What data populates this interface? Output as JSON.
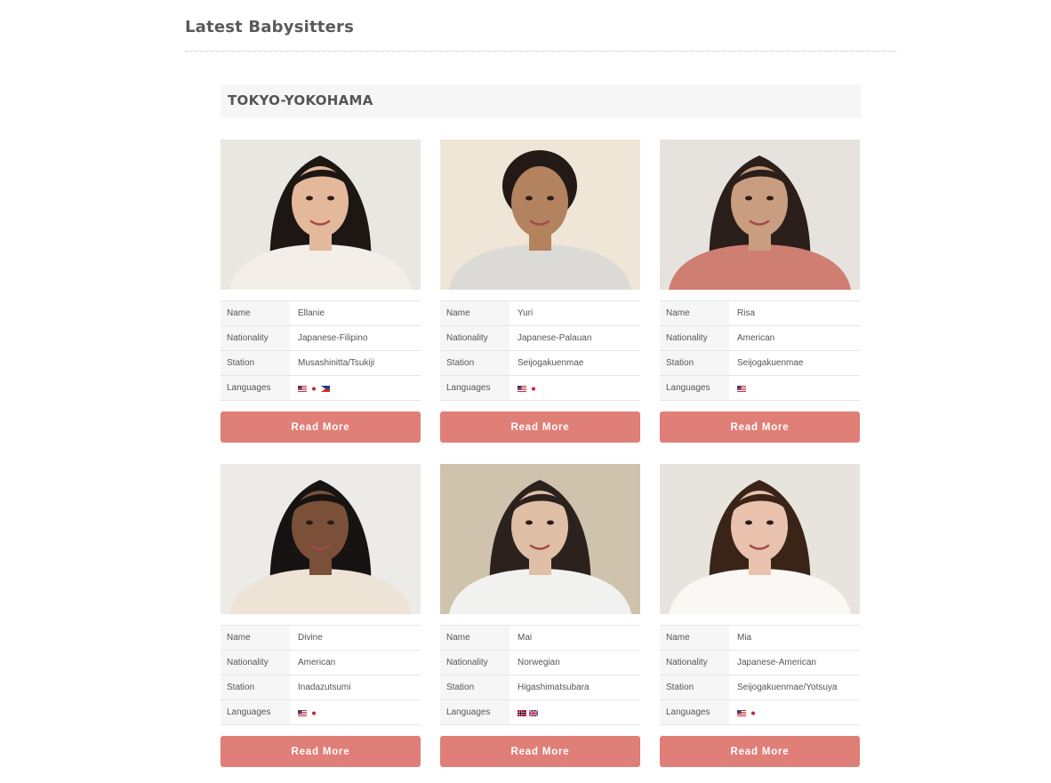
{
  "page": {
    "title": "Latest Babysitters"
  },
  "region": {
    "name": "TOKYO-YOKOHAMA"
  },
  "labels": {
    "name": "Name",
    "nationality": "Nationality",
    "station": "Station",
    "languages": "Languages",
    "read_more": "Read More"
  },
  "sitters": [
    {
      "name": "Ellanie",
      "nationality": "Japanese-Filipino",
      "station": "Musashinitta/Tsukiji",
      "languages": [
        "us-flag-icon",
        "jp-flag-icon",
        "ph-flag-icon"
      ],
      "bg": "#e9e7e1",
      "hair": "#1d1714",
      "skin": "#e3b89b",
      "shirt": "#f3efe8"
    },
    {
      "name": "Yuri",
      "nationality": "Japanese-Palauan",
      "station": "Seijogakuenmae",
      "languages": [
        "us-flag-icon",
        "jp-flag-icon"
      ],
      "bg": "#efe6d8",
      "hair": "#231a16",
      "skin": "#b3835f",
      "shirt": "#dcdad6"
    },
    {
      "name": "Risa",
      "nationality": "American",
      "station": "Seijogakuenmae",
      "languages": [
        "us-flag-icon"
      ],
      "bg": "#e6e3de",
      "hair": "#2a1f1a",
      "skin": "#c99d7f",
      "shirt": "#cf7e72"
    },
    {
      "name": "Divine",
      "nationality": "American",
      "station": "Inadazutsumi",
      "languages": [
        "us-flag-icon",
        "jp-flag-icon"
      ],
      "bg": "#ecebe7",
      "hair": "#161312",
      "skin": "#7b5038",
      "shirt": "#ede4d6"
    },
    {
      "name": "Mai",
      "nationality": "Norwegian",
      "station": "Higashimatsubara",
      "languages": [
        "no-flag-icon",
        "gb-flag-icon"
      ],
      "bg": "#cfc3ad",
      "hair": "#2c221d",
      "skin": "#dfbfa5",
      "shirt": "#f1f1ef"
    },
    {
      "name": "Mia",
      "nationality": "Japanese-American",
      "station": "Seijogakuenmae/Yotsuya",
      "languages": [
        "us-flag-icon",
        "jp-flag-icon"
      ],
      "bg": "#e7e4de",
      "hair": "#3a2418",
      "skin": "#e8c2ad",
      "shirt": "#faf8f4"
    }
  ]
}
